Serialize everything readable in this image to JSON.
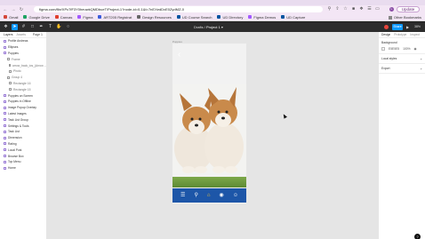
{
  "browser": {
    "url": "figma.com/file/XPc7fF3Y0heuwkQMDbueT/Project-1?node-id=0-1&t=7nEXedDxE0ZydMZ-0",
    "update_label": "Update",
    "profile_initial": "L"
  },
  "bookmarks": [
    {
      "label": "Gmail",
      "color": "#d44638"
    },
    {
      "label": "Google Drive",
      "color": "#1ea362"
    },
    {
      "label": "Canvas",
      "color": "#e03e2d"
    },
    {
      "label": "Figma",
      "color": "#a259ff"
    },
    {
      "label": "ART205 Registrat",
      "color": "#3b5bdb"
    },
    {
      "label": "Design Resources",
      "color": "#666666"
    },
    {
      "label": "UD Course Search",
      "color": "#00539f"
    },
    {
      "label": "UD Directory",
      "color": "#00539f"
    },
    {
      "label": "Figma Demos",
      "color": "#a259ff"
    },
    {
      "label": "UD Capture",
      "color": "#00539f"
    }
  ],
  "bookmarks_other": "Other Bookmarks",
  "figma": {
    "file_location": "Drafts",
    "file_name": "Project 1",
    "share_label": "Share",
    "zoom": "38%"
  },
  "left_panel": {
    "tabs": [
      "Layers",
      "Assets"
    ],
    "page_label": "Page 1",
    "layers": [
      {
        "label": "Profile Andreas",
        "level": 0
      },
      {
        "label": "Ellipses",
        "level": 0
      },
      {
        "label": "Puppies",
        "level": 0
      },
      {
        "label": "Frame",
        "level": 1
      },
      {
        "label": "arrow_back_ios_(Arrow ...)",
        "level": 2
      },
      {
        "label": "Photo",
        "level": 2
      },
      {
        "label": "Group 4",
        "level": 1
      },
      {
        "label": "Rectangle 16",
        "level": 2
      },
      {
        "label": "Rectangle 15",
        "level": 2
      },
      {
        "label": "Puppies on Screen",
        "level": 0
      },
      {
        "label": "Puppies in Offline",
        "level": 0
      },
      {
        "label": "Image Popup Overlay",
        "level": 0
      },
      {
        "label": "Latest Images",
        "level": 0
      },
      {
        "label": "Task List Group",
        "level": 0
      },
      {
        "label": "Settings & Tools",
        "level": 0
      },
      {
        "label": "Task List",
        "level": 0
      },
      {
        "label": "Dimension",
        "level": 0
      },
      {
        "label": "Rating",
        "level": 0
      },
      {
        "label": "Local Post",
        "level": 0
      },
      {
        "label": "Browse Box",
        "level": 0
      },
      {
        "label": "Top Menu",
        "level": 0
      },
      {
        "label": "Home",
        "level": 0
      }
    ]
  },
  "canvas": {
    "frame_label": "Puppies",
    "background": "#e5e5e5",
    "nav_icons": [
      "library-icon",
      "search-icon",
      "home-icon",
      "profile-icon",
      "account-icon"
    ]
  },
  "right_panel": {
    "tabs": [
      "Design",
      "Prototype",
      "Inspect"
    ],
    "background_title": "Background",
    "background_hex": "E5E5E5",
    "background_opacity": "100%",
    "local_styles": "Local styles",
    "export_label": "Export"
  }
}
